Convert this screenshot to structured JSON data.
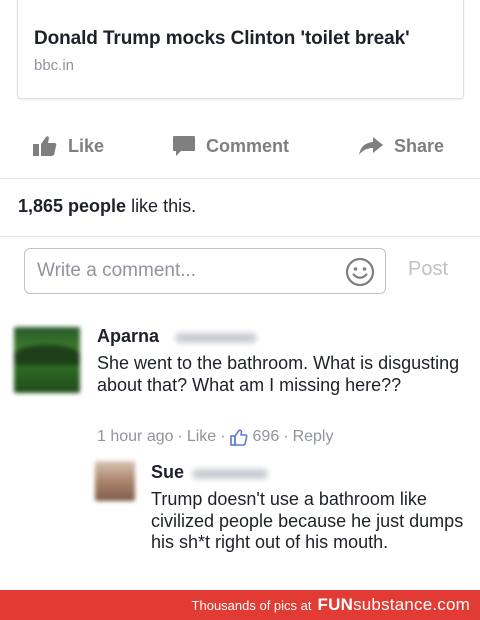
{
  "link_preview": {
    "title": "Donald Trump mocks Clinton 'toilet break'",
    "domain": "bbc.in"
  },
  "actions": {
    "like_label": "Like",
    "comment_label": "Comment",
    "share_label": "Share"
  },
  "likes_summary": {
    "count": "1,865 people",
    "suffix": " like this."
  },
  "comment_composer": {
    "placeholder": "Write a comment...",
    "post_label": "Post"
  },
  "comments": [
    {
      "author": "Aparna",
      "text": "She went to the bathroom. What is disgusting about that? What am I missing here??",
      "time": "1 hour ago",
      "like_label": "Like",
      "reaction_count": "696",
      "reply_label": "Reply"
    },
    {
      "author": "Sue",
      "text": "Trump doesn't use a bathroom like civilized people because he just dumps his sh*t right out of his mouth."
    }
  ],
  "watermark": {
    "text": "Thousands of pics at",
    "brand_part1": "FUN",
    "brand_part2": "substance",
    "brand_part3": ".com"
  },
  "colors": {
    "text": "#1d2129",
    "muted": "#90949c",
    "watermark_bg": "#e23b34"
  },
  "icons": [
    "like-thumb-icon",
    "comment-bubble-icon",
    "share-arrow-icon",
    "emoji-icon",
    "small-like-thumb-icon"
  ]
}
